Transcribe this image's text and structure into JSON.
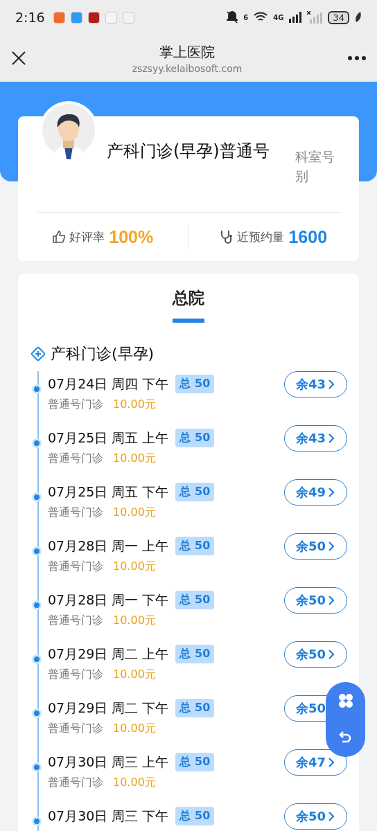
{
  "status_bar": {
    "time": "2:16",
    "network": "4G",
    "battery": "34",
    "wifi_badge": "6"
  },
  "nav": {
    "title": "掌上医院",
    "url": "zszsyy.kelaibosoft.com"
  },
  "doctor": {
    "name": "产科门诊(早孕)普通号",
    "title": "科室号别",
    "rating_label": "好评率",
    "rating": "100%",
    "bookings_label": "近预约量",
    "bookings": "1600"
  },
  "tabs": [
    {
      "label": "总院",
      "selected": true
    }
  ],
  "department": "产科门诊(早孕)",
  "slots": [
    {
      "date": "07月24日 周四 下午",
      "total": "总 50",
      "type": "普通号门诊",
      "fee": "10.00元",
      "remain": "余43"
    },
    {
      "date": "07月25日 周五 上午",
      "total": "总 50",
      "type": "普通号门诊",
      "fee": "10.00元",
      "remain": "余43"
    },
    {
      "date": "07月25日 周五 下午",
      "total": "总 50",
      "type": "普通号门诊",
      "fee": "10.00元",
      "remain": "余49"
    },
    {
      "date": "07月28日 周一 上午",
      "total": "总 50",
      "type": "普通号门诊",
      "fee": "10.00元",
      "remain": "余50"
    },
    {
      "date": "07月28日 周一 下午",
      "total": "总 50",
      "type": "普通号门诊",
      "fee": "10.00元",
      "remain": "余50"
    },
    {
      "date": "07月29日 周二 上午",
      "total": "总 50",
      "type": "普通号门诊",
      "fee": "10.00元",
      "remain": "余50"
    },
    {
      "date": "07月29日 周二 下午",
      "total": "总 50",
      "type": "普通号门诊",
      "fee": "10.00元",
      "remain": "余50",
      "covered": true
    },
    {
      "date": "07月30日 周三 上午",
      "total": "总 50",
      "type": "普通号门诊",
      "fee": "10.00元",
      "remain": "余47"
    },
    {
      "date": "07月30日 周三 下午",
      "total": "总 50",
      "remain": "余50"
    }
  ]
}
